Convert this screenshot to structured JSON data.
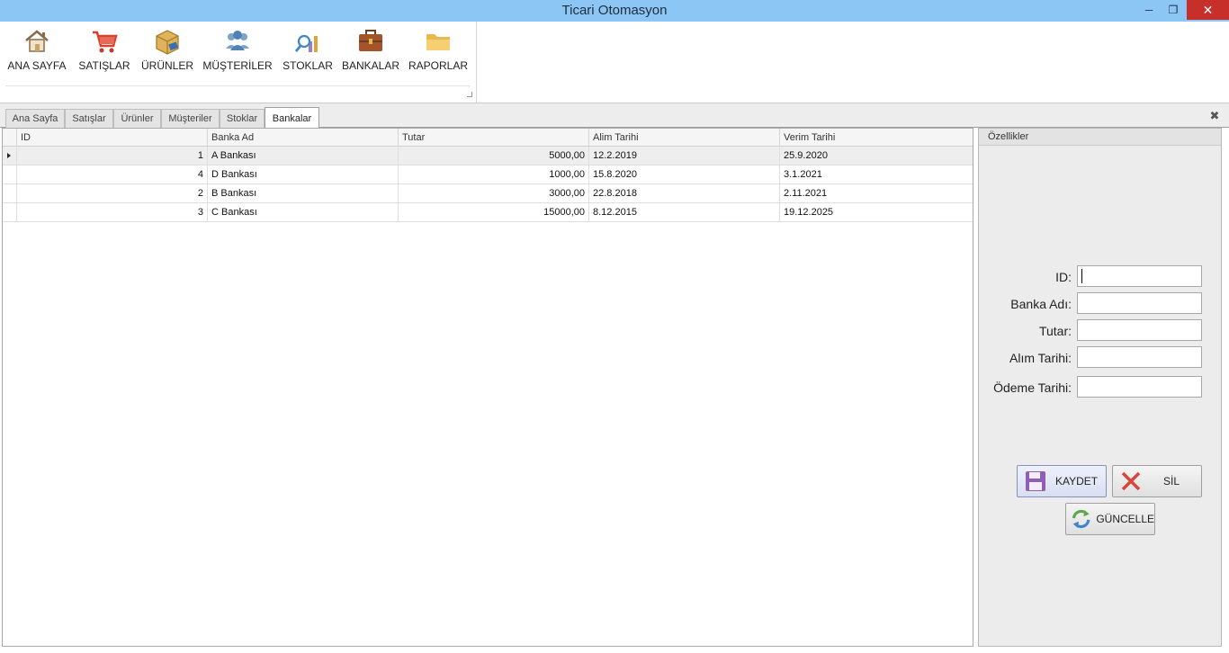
{
  "window": {
    "title": "Ticari Otomasyon"
  },
  "ribbon": {
    "buttons": [
      {
        "label": "ANA SAYFA",
        "icon": "home-icon"
      },
      {
        "label": "SATIŞLAR",
        "icon": "cart-icon"
      },
      {
        "label": "ÜRÜNLER",
        "icon": "box-icon"
      },
      {
        "label": "MÜŞTERİLER",
        "icon": "users-icon"
      },
      {
        "label": "STOKLAR",
        "icon": "chart-search-icon"
      },
      {
        "label": "BANKALAR",
        "icon": "briefcase-icon"
      },
      {
        "label": "RAPORLAR",
        "icon": "folder-icon"
      }
    ]
  },
  "tabs": [
    {
      "label": "Ana Sayfa"
    },
    {
      "label": "Satışlar"
    },
    {
      "label": "Ürünler"
    },
    {
      "label": "Müşteriler"
    },
    {
      "label": "Stoklar"
    },
    {
      "label": "Bankalar",
      "active": true
    }
  ],
  "grid": {
    "columns": [
      "ID",
      "Banka Ad",
      "Tutar",
      "Alim Tarihi",
      "Verim Tarihi"
    ],
    "rows": [
      {
        "id": "1",
        "banka": "A Bankası",
        "tutar": "5000,00",
        "alim": "12.2.2019",
        "verim": "25.9.2020",
        "selected": true
      },
      {
        "id": "4",
        "banka": "D Bankası",
        "tutar": "1000,00",
        "alim": "15.8.2020",
        "verim": "3.1.2021"
      },
      {
        "id": "2",
        "banka": "B Bankası",
        "tutar": "3000,00",
        "alim": "22.8.2018",
        "verim": "2.11.2021"
      },
      {
        "id": "3",
        "banka": "C Bankası",
        "tutar": "15000,00",
        "alim": "8.12.2015",
        "verim": "19.12.2025"
      }
    ]
  },
  "panel": {
    "title": "Özellikler",
    "fields": [
      {
        "label": "ID:",
        "value": ""
      },
      {
        "label": "Banka Adı:",
        "value": ""
      },
      {
        "label": "Tutar:",
        "value": ""
      },
      {
        "label": "Alım Tarihi:",
        "value": ""
      },
      {
        "label": "Ödeme Tarihi:",
        "value": ""
      }
    ],
    "buttons": {
      "save": "KAYDET",
      "delete": "SİL",
      "update": "GÜNCELLE"
    }
  },
  "colors": {
    "titlebar": "#8cc6f5",
    "close": "#c7302a",
    "save_icon": "#8e5fb3",
    "delete_icon": "#d6463a",
    "update_icon_green": "#5fa84a",
    "update_icon_blue": "#3f86c8"
  }
}
